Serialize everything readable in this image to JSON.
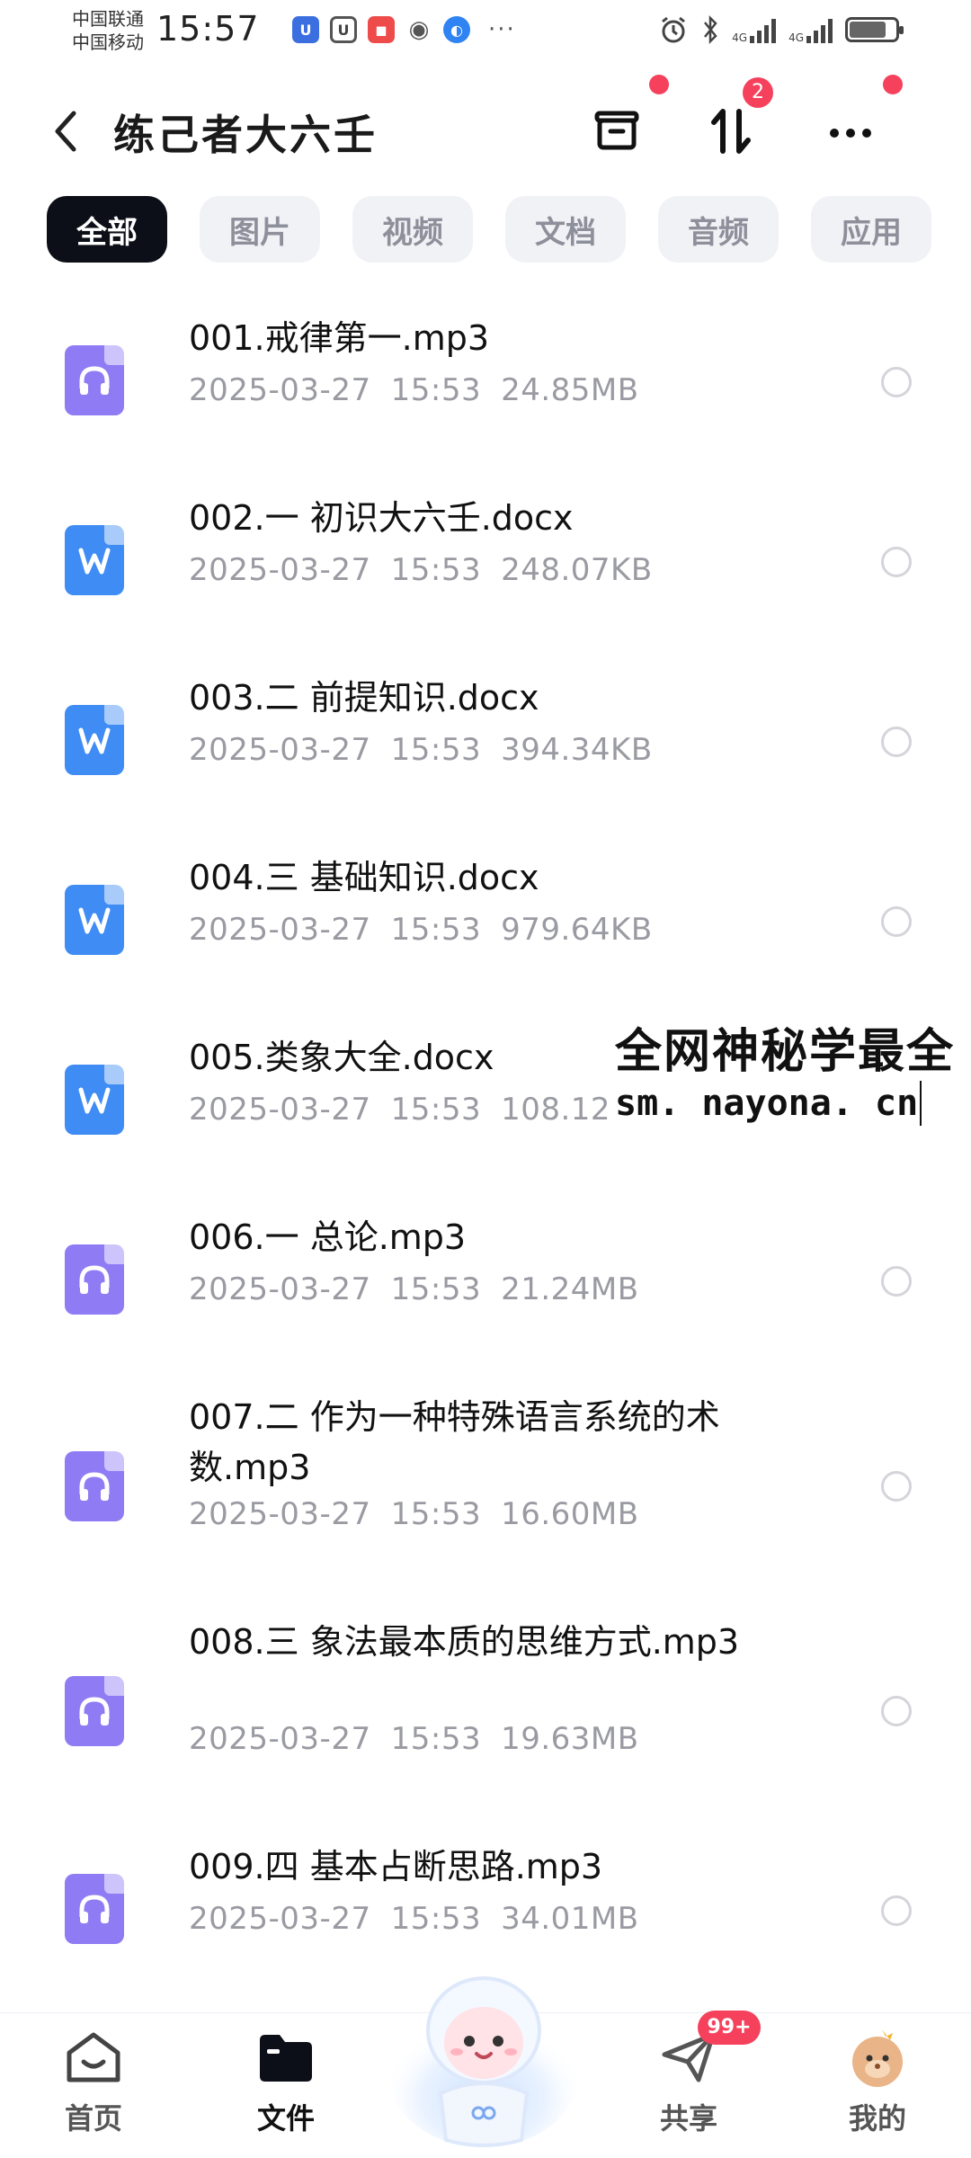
{
  "status_bar": {
    "carrier1": "中国联通",
    "carrier2": "中国移动",
    "time": "15:57",
    "more": "···",
    "net1": "4G",
    "net2": "4G"
  },
  "header": {
    "title": "练己者大六壬",
    "sort_badge": "2"
  },
  "tabs": [
    {
      "label": "全部",
      "active": true
    },
    {
      "label": "图片",
      "active": false
    },
    {
      "label": "视频",
      "active": false
    },
    {
      "label": "文档",
      "active": false
    },
    {
      "label": "音频",
      "active": false
    },
    {
      "label": "应用",
      "active": false
    }
  ],
  "files": [
    {
      "name": "001.戒律第一.mp3",
      "date": "2025-03-27",
      "time": "15:53",
      "size": "24.85MB",
      "type": "audio"
    },
    {
      "name": "002.一 初识大六壬.docx",
      "date": "2025-03-27",
      "time": "15:53",
      "size": "248.07KB",
      "type": "word"
    },
    {
      "name": "003.二 前提知识.docx",
      "date": "2025-03-27",
      "time": "15:53",
      "size": "394.34KB",
      "type": "word"
    },
    {
      "name": "004.三 基础知识.docx",
      "date": "2025-03-27",
      "time": "15:53",
      "size": "979.64KB",
      "type": "word"
    },
    {
      "name": "005.类象大全.docx",
      "date": "2025-03-27",
      "time": "15:53",
      "size": "108.12KB",
      "type": "word"
    },
    {
      "name": "006.一 总论.mp3",
      "date": "2025-03-27",
      "time": "15:53",
      "size": "21.24MB",
      "type": "audio"
    },
    {
      "name": "007.二 作为一种特殊语言系统的术数.mp3",
      "date": "2025-03-27",
      "time": "15:53",
      "size": "16.60MB",
      "type": "audio"
    },
    {
      "name": "008.三 象法最本质的思维方式.mp3",
      "date": "2025-03-27",
      "time": "15:53",
      "size": "19.63MB",
      "type": "audio"
    },
    {
      "name": "009.四 基本占断思路.mp3",
      "date": "2025-03-27",
      "time": "15:53",
      "size": "34.01MB",
      "type": "audio"
    }
  ],
  "watermark": {
    "text": "全网神秘学最全",
    "url": "sm. nayona. cn"
  },
  "bottom_nav": {
    "home": "首页",
    "files": "文件",
    "share": "共享",
    "share_badge": "99+",
    "mine": "我的"
  },
  "colors": {
    "accent_dark": "#0c0f17",
    "audio_icon": "#8f7cf5",
    "word_icon": "#3f8cf4",
    "badge_red": "#f5415c",
    "meta_gray": "#9a9ba2"
  }
}
